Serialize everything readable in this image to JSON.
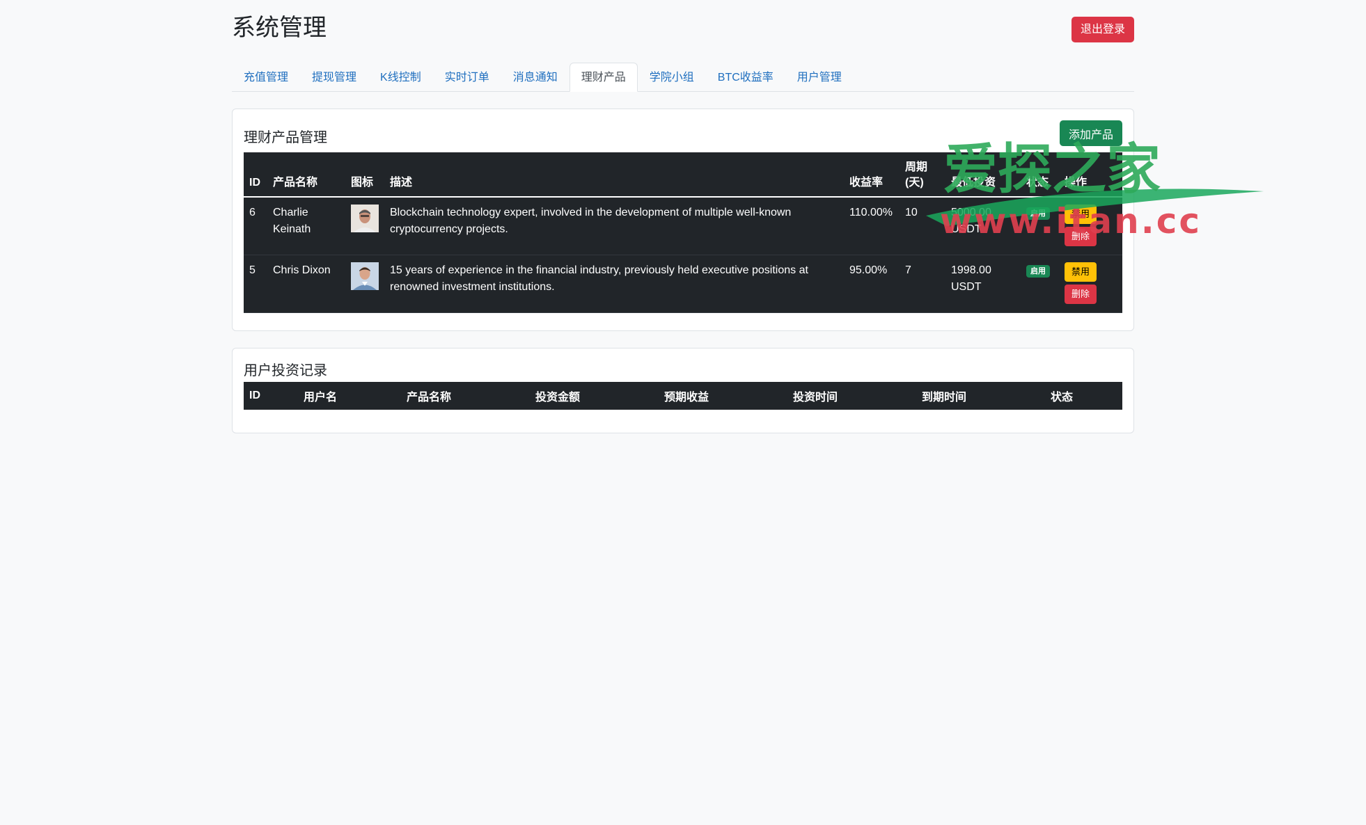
{
  "header": {
    "title": "系统管理",
    "logout_label": "退出登录"
  },
  "tabs": [
    {
      "label": "充值管理",
      "active": false
    },
    {
      "label": "提现管理",
      "active": false
    },
    {
      "label": "K线控制",
      "active": false
    },
    {
      "label": "实时订单",
      "active": false
    },
    {
      "label": "消息通知",
      "active": false
    },
    {
      "label": "理财产品",
      "active": true
    },
    {
      "label": "学院小组",
      "active": false
    },
    {
      "label": "BTC收益率",
      "active": false
    },
    {
      "label": "用户管理",
      "active": false
    }
  ],
  "products": {
    "title": "理财产品管理",
    "add_label": "添加产品",
    "columns": {
      "id": "ID",
      "name": "产品名称",
      "icon": "图标",
      "desc": "描述",
      "rate": "收益率",
      "period": "周期(天)",
      "min": "最低投资",
      "status": "状态",
      "ops": "操作"
    },
    "rows": [
      {
        "id": "6",
        "name": "Charlie Keinath",
        "desc": "Blockchain technology expert, involved in the development of multiple well-known cryptocurrency projects.",
        "rate": "110.00%",
        "period": "10",
        "min": "5000.00 USDT",
        "status": "启用",
        "disable_label": "禁用",
        "delete_label": "删除"
      },
      {
        "id": "5",
        "name": "Chris Dixon",
        "desc": "15 years of experience in the financial industry, previously held executive positions at renowned investment institutions.",
        "rate": "95.00%",
        "period": "7",
        "min": "1998.00 USDT",
        "status": "启用",
        "disable_label": "禁用",
        "delete_label": "删除"
      }
    ]
  },
  "records": {
    "title": "用户投资记录",
    "columns": [
      "ID",
      "用户名",
      "产品名称",
      "投资金额",
      "预期收益",
      "投资时间",
      "到期时间",
      "状态"
    ]
  },
  "watermark": {
    "line1": "爱探之家",
    "line2": "www.itan.cc"
  },
  "colors": {
    "danger": "#dc3545",
    "success": "#198754",
    "warning": "#ffc107",
    "dark": "#212529"
  }
}
